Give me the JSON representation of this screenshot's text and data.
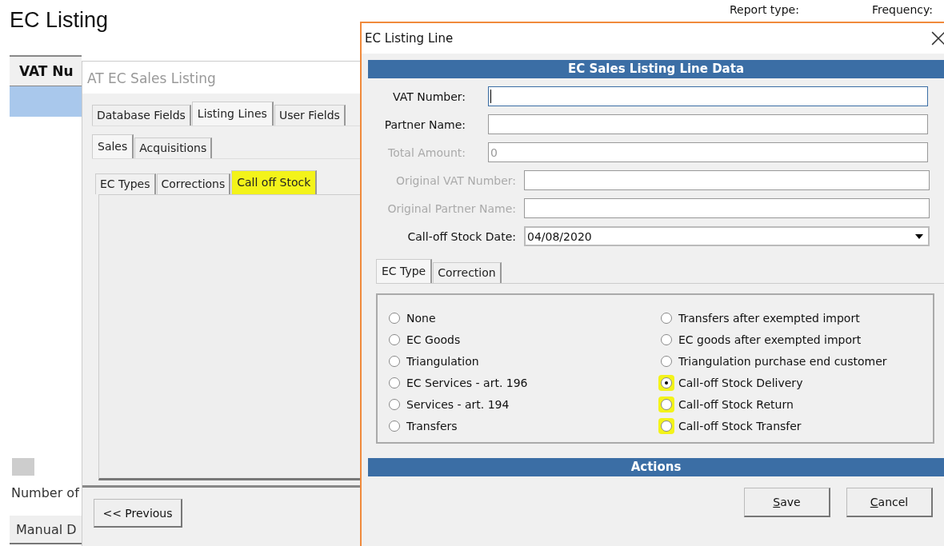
{
  "page": {
    "title": "EC Listing",
    "column_1": "VAT Nu",
    "report_type_label": "Report type:",
    "frequency_label": "Frequency:",
    "footer_label": "Number of",
    "footer_button": "Manual D",
    "rows": [
      {
        "selected": true
      }
    ]
  },
  "sales_window": {
    "title": "AT EC Sales Listing",
    "tabs": [
      {
        "label": "Database Fields",
        "selected": false
      },
      {
        "label": "Listing Lines",
        "selected": true
      },
      {
        "label": "User Fields",
        "selected": false
      }
    ],
    "sub_tabs": [
      {
        "label": "Sales",
        "selected": true
      },
      {
        "label": "Acquisitions",
        "selected": false
      }
    ],
    "type_tabs": [
      {
        "label": "EC Types",
        "selected": false,
        "highlighted": false
      },
      {
        "label": "Corrections",
        "selected": false,
        "highlighted": false
      },
      {
        "label": "Call off Stock",
        "selected": true,
        "highlighted": true
      }
    ],
    "previous_button": "<< Previous"
  },
  "line_window": {
    "title": "EC Listing Line",
    "section_title": "EC Sales Listing Line Data",
    "fields": [
      {
        "label": "VAT Number:",
        "disabled": false,
        "focused": true
      },
      {
        "label": "Partner Name:",
        "disabled": false,
        "focused": false
      },
      {
        "label": "Total Amount:",
        "value": "0",
        "disabled": true,
        "focused": false
      }
    ],
    "original_fields": [
      {
        "label": "Original VAT Number:",
        "disabled": true,
        "kind": "text"
      },
      {
        "label": "Original Partner Name:",
        "disabled": true,
        "kind": "text"
      },
      {
        "label": "Call-off Stock Date:",
        "value": "04/08/2020",
        "disabled": false,
        "kind": "dropdown"
      }
    ],
    "tabs": [
      {
        "label": "EC Type",
        "selected": true
      },
      {
        "label": "Correction",
        "selected": false
      }
    ],
    "radio_columns": [
      [
        {
          "label": "None",
          "selected": false,
          "highlighted": false
        },
        {
          "label": "EC Goods",
          "selected": false,
          "highlighted": false
        },
        {
          "label": "Triangulation",
          "selected": false,
          "highlighted": false
        },
        {
          "label": "EC Services - art. 196",
          "selected": false,
          "highlighted": false
        },
        {
          "label": "Services - art. 194",
          "selected": false,
          "highlighted": false
        },
        {
          "label": "Transfers",
          "selected": false,
          "highlighted": false
        }
      ],
      [
        {
          "label": "Transfers after exempted import",
          "selected": false,
          "highlighted": false
        },
        {
          "label": "EC goods after exempted import",
          "selected": false,
          "highlighted": false
        },
        {
          "label": "Triangulation purchase end customer",
          "selected": false,
          "highlighted": false
        },
        {
          "label": "Call-off Stock Delivery",
          "selected": true,
          "highlighted": true
        },
        {
          "label": "Call-off Stock Return",
          "selected": false,
          "highlighted": true
        },
        {
          "label": "Call-off Stock Transfer",
          "selected": false,
          "highlighted": true
        }
      ]
    ],
    "actions_title": "Actions",
    "buttons": [
      "Save",
      "Cancel"
    ]
  }
}
